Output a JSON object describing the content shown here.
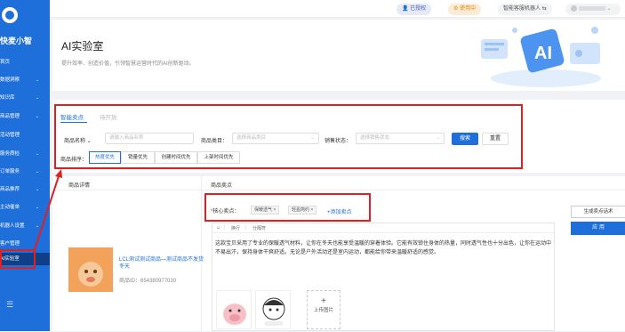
{
  "app": {
    "name": "快麦小智"
  },
  "sidebar": {
    "items": [
      {
        "label": "首页",
        "chevron": false
      },
      {
        "label": "数据洞察",
        "chevron": true
      },
      {
        "label": "知识库",
        "chevron": true
      },
      {
        "label": "商品管理",
        "chevron": true
      },
      {
        "label": "活动管理",
        "chevron": false
      },
      {
        "label": "服务质检",
        "chevron": true
      },
      {
        "label": "订单服务",
        "chevron": true
      },
      {
        "label": "商品推荐",
        "chevron": true
      },
      {
        "label": "主动催单",
        "chevron": true
      },
      {
        "label": "机器人设置",
        "chevron": true
      },
      {
        "label": "客户管理",
        "chevron": false
      },
      {
        "label": "AI实验室",
        "chevron": false
      }
    ],
    "collapse_icon": "collapse-icon"
  },
  "topbar": {
    "authorized": "已授权",
    "in_use": "使用中",
    "robot": "智能客服机器人",
    "robot_icon": "swap-icon"
  },
  "header": {
    "title": "AI实验室",
    "subtitle": "提升效率、创造价值，引领智慧运营时代的AI创新驱动。"
  },
  "tabs": [
    {
      "label": "智能卖点",
      "active": true
    },
    {
      "label": "待开放",
      "active": false
    }
  ],
  "filters": {
    "name_label": "商品名称",
    "name_placeholder": "请输入商品名称",
    "category_label": "商品类目：",
    "category_placeholder": "选择商品类目",
    "status_label": "销售状态：",
    "status_placeholder": "选择销售状态",
    "search": "搜索",
    "reset": "重置"
  },
  "sort": {
    "label": "商品排序：",
    "options": [
      "热度优先",
      "销量优先",
      "创建时间优先",
      "上架时间优先"
    ],
    "active_index": 0
  },
  "table": {
    "col_detail": "商品详情",
    "col_selling": "商品卖点"
  },
  "product": {
    "name": "LCL测试测试商品—测试商品不发货冬天",
    "id_text": "商品ID：654380977030"
  },
  "keywords": {
    "label": "核心卖点：",
    "tags": [
      "保暖透气",
      "轻盈简约"
    ],
    "add": "+添加卖点"
  },
  "editor": {
    "toolbar": [
      "换行",
      "分隔符"
    ],
    "text": "这款宝贝采用了专业的保暖透气材料，让你在冬天也能享受温暖的穿着体验。它能有效锁住身体的热量，同时透气性也十分出色，让你在运动中不易出汗，保持身体干爽舒适。无论是户外活动还是室内运动，都能给你带来温暖舒适的感觉。",
    "upload": "上传图片"
  },
  "actions": {
    "generate": "生成卖点话术",
    "apply": "应 用"
  },
  "colors": {
    "primary": "#1e6fd9",
    "highlight": "#e02020"
  }
}
